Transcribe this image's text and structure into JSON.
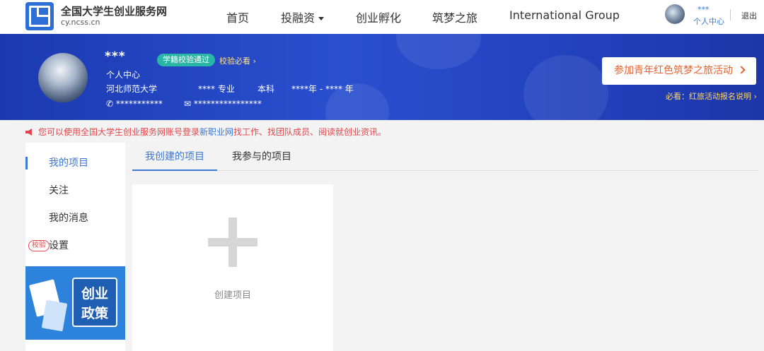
{
  "header": {
    "site_title": "全国大学生创业服务网",
    "site_url": "cy.ncss.cn",
    "nav": [
      {
        "label": "首页"
      },
      {
        "label": "投融资"
      },
      {
        "label": "创业孵化"
      },
      {
        "label": "筑梦之旅"
      },
      {
        "label": "International Group"
      }
    ],
    "user_name": "***",
    "user_center": "个人中心",
    "logout": "退出"
  },
  "profile": {
    "name": "***",
    "verify_badge": "学籍校验通过",
    "verify_link": "校验必看",
    "role": "个人中心",
    "school": "河北师范大学",
    "major": "**** 专业",
    "degree": "本科",
    "years": "****年 - **** 年",
    "phone": "***********",
    "email": "****************"
  },
  "cta": {
    "button": "参加青年红色筑梦之旅活动",
    "note": "必看：红旅活动报名说明"
  },
  "notice": {
    "prefix": "您可以使用全国大学生创业服务网账号登录",
    "link": "新职业网",
    "suffix": "找工作、找团队成员、阅读就创业资讯。"
  },
  "sidebar": {
    "items": [
      {
        "label": "我的项目"
      },
      {
        "label": "关注"
      },
      {
        "label": "我的消息"
      },
      {
        "label": "设置",
        "badge": "校验"
      }
    ],
    "policy_banner": [
      "创业",
      "政策"
    ]
  },
  "tabs": [
    {
      "label": "我创建的项目"
    },
    {
      "label": "我参与的项目"
    }
  ],
  "create_card": {
    "label": "创建项目"
  },
  "colors": {
    "brand_blue": "#2d6fd6",
    "active_blue": "#3b78d8",
    "notice_red": "#e3474d",
    "cta_orange": "#e8612e",
    "badge_teal": "#29b6a4"
  }
}
